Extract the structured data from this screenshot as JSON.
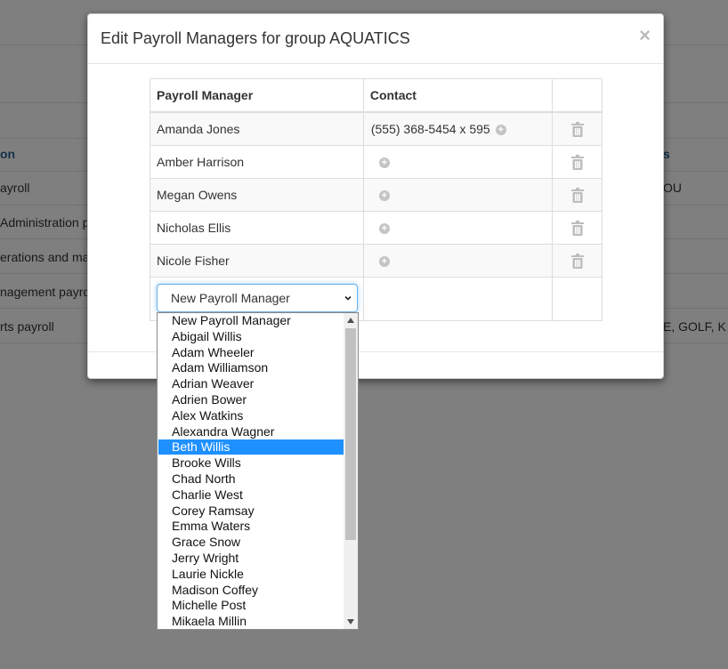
{
  "background": {
    "col_header": "on",
    "col_header_right": "s",
    "rows": [
      "ayroll",
      "Administration pa",
      "erations and ma",
      "nagement payro",
      "rts payroll"
    ],
    "rows_right": [
      "OU",
      "",
      "",
      "",
      "E, GOLF, K"
    ]
  },
  "modal": {
    "title": "Edit Payroll Managers for group AQUATICS",
    "close": "×"
  },
  "table": {
    "headers": [
      "Payroll Manager",
      "Contact",
      ""
    ],
    "rows": [
      {
        "name": "Amanda Jones",
        "contact": "(555) 368-5454 x 595"
      },
      {
        "name": "Amber Harrison",
        "contact": ""
      },
      {
        "name": "Megan Owens",
        "contact": ""
      },
      {
        "name": "Nicholas Ellis",
        "contact": ""
      },
      {
        "name": "Nicole Fisher",
        "contact": ""
      }
    ]
  },
  "select": {
    "value": "New Payroll Manager",
    "options": [
      "New Payroll Manager",
      "Abigail Willis",
      "Adam Wheeler",
      "Adam Williamson",
      "Adrian Weaver",
      "Adrien Bower",
      "Alex Watkins",
      "Alexandra Wagner",
      "Beth Willis",
      "Brooke Wills",
      "Chad North",
      "Charlie West",
      "Corey Ramsay",
      "Emma Waters",
      "Grace Snow",
      "Jerry Wright",
      "Laurie Nickle",
      "Madison Coffey",
      "Michelle Post",
      "Mikaela Millin"
    ],
    "highlighted": "Beth Willis"
  },
  "colors": {
    "highlight": "#1e90ff",
    "focus_border": "#66afe9"
  }
}
